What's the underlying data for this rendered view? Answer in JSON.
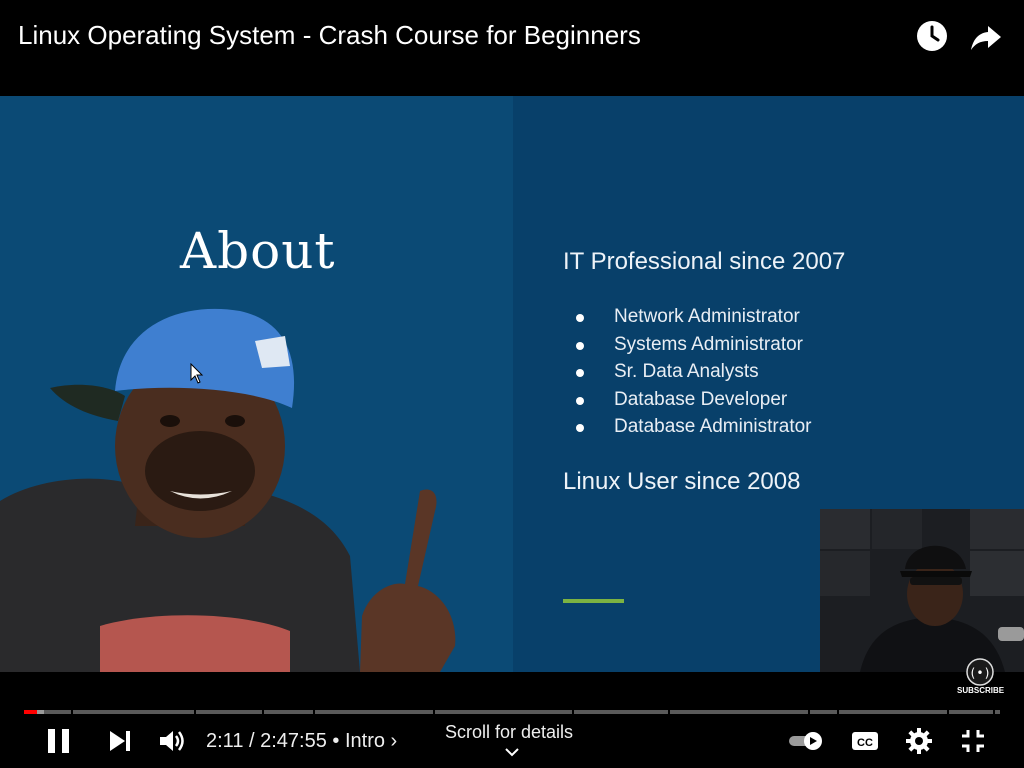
{
  "header": {
    "title": "Linux Operating System - Crash Course for Beginners",
    "watch_later_icon": "clock-icon",
    "share_icon": "share-arrow-icon"
  },
  "slide": {
    "heading": "About",
    "subheading": "IT Professional since 2007",
    "roles": [
      "Network Administrator",
      "Systems Administrator",
      "Sr. Data Analysts",
      "Database Developer",
      "Database Administrator"
    ],
    "footer": "Linux User since 2008"
  },
  "overlay": {
    "subscribe_label": "SUBSCRIBE"
  },
  "player": {
    "current_time": "2:11",
    "duration": "2:47:55",
    "chapter": "Intro",
    "time_display": "2:11 / 2:47:55 • Intro ›",
    "scroll_hint": "Scroll for details",
    "progress_fraction": 0.013,
    "buffered_fraction": 0.021,
    "icons": [
      "pause-icon",
      "next-icon",
      "volume-icon",
      "autoplay-toggle",
      "captions-icon",
      "settings-icon",
      "exit-fullscreen-icon"
    ]
  },
  "colors": {
    "played": "#ff0000",
    "accent_green": "#7cb342",
    "slide_blue": "#0b4a75"
  }
}
